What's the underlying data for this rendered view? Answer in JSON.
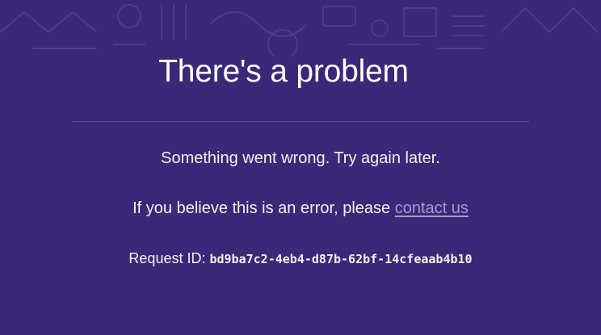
{
  "colors": {
    "background": "#3a2878",
    "text": "#ffffff",
    "link": "#a99bd0",
    "divider": "#5c4d96"
  },
  "error": {
    "title": "There's a problem",
    "message": "Something went wrong. Try again later.",
    "contact_prefix": "If you believe this is an error, please ",
    "contact_link_label": "contact us",
    "request_label": "Request ID: ",
    "request_id": "bd9ba7c2-4eb4-d87b-62bf-14cfeaab4b10"
  }
}
